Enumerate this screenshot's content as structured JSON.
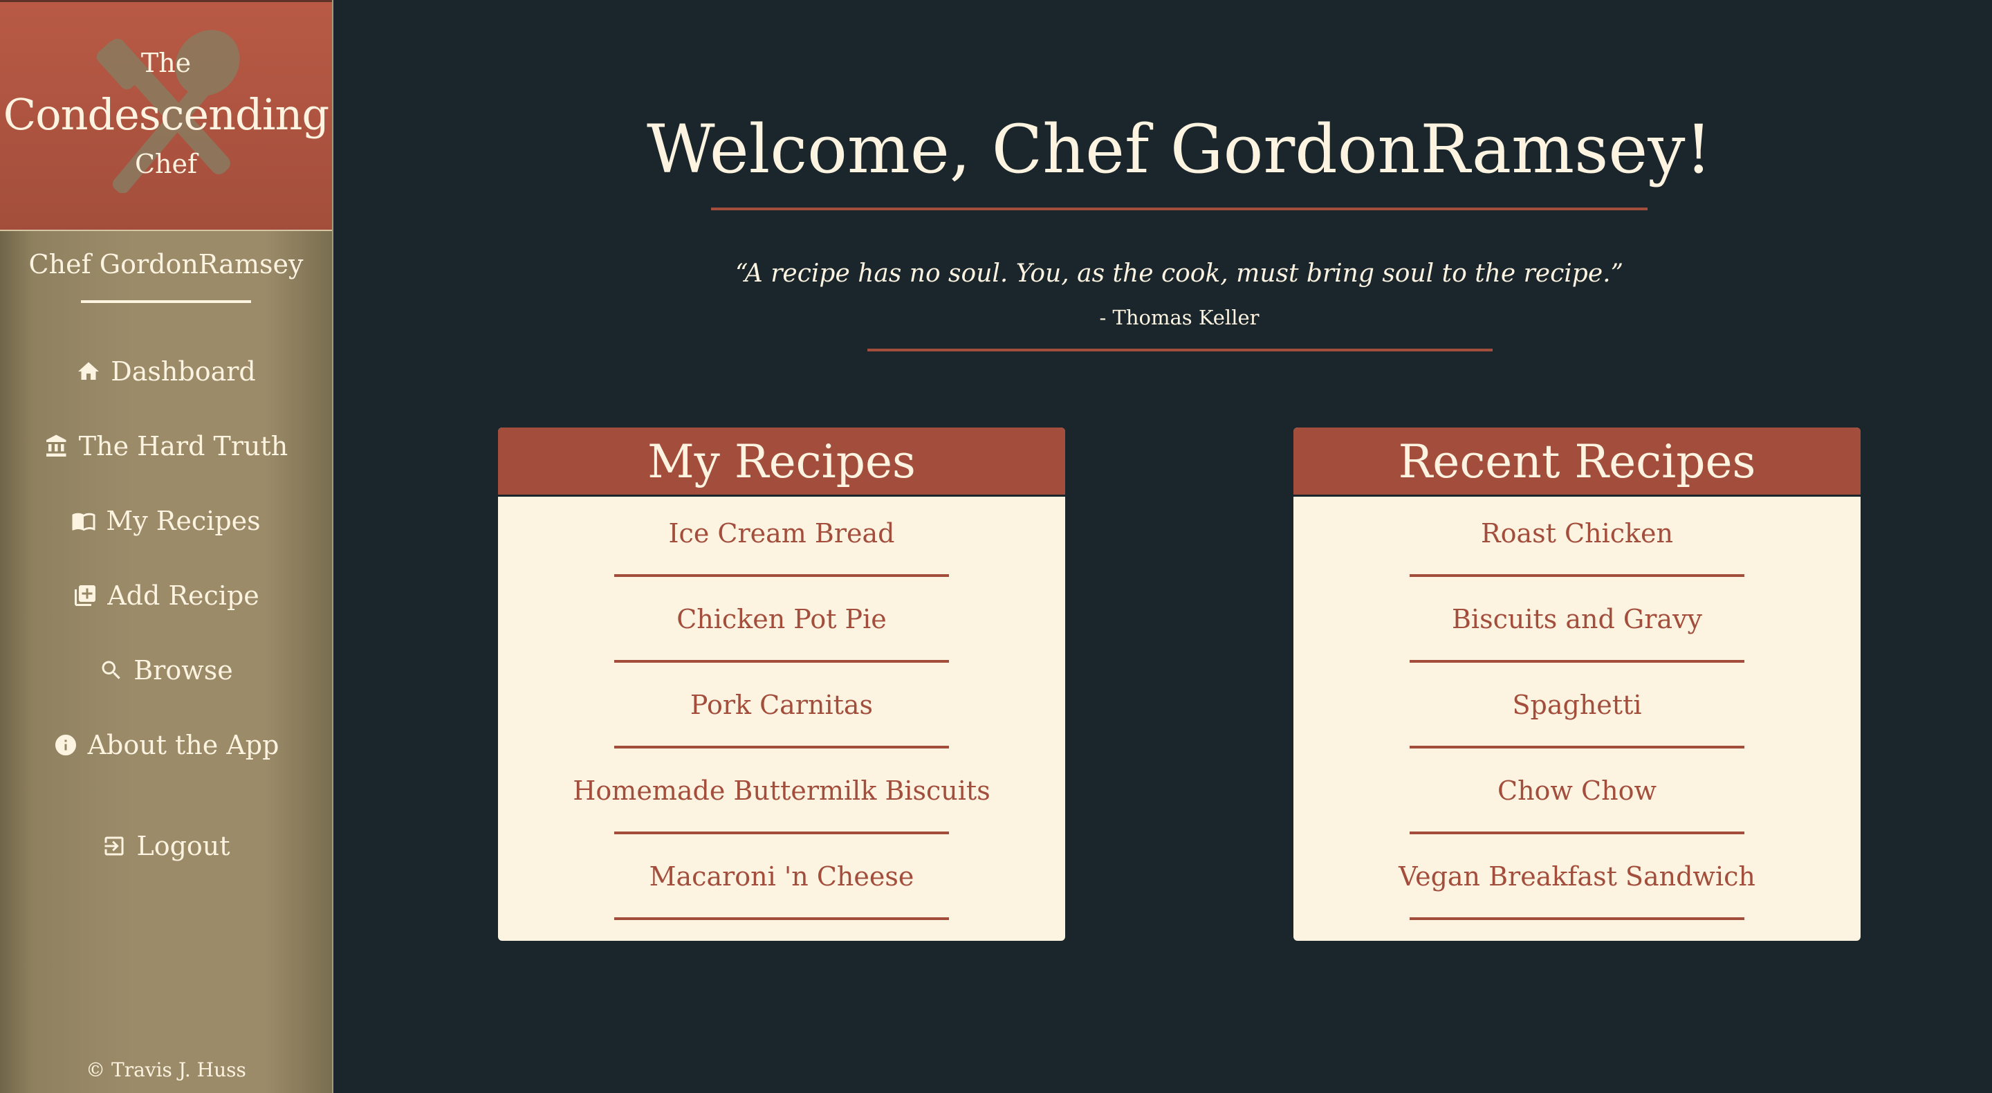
{
  "app": {
    "logo": {
      "line1": "The",
      "line2": "Condescending",
      "line3": "Chef",
      "art": "crossed-fork-spoon-icon"
    },
    "footer": "© Travis J. Huss"
  },
  "sidebar": {
    "chef_name": "Chef GordonRamsey",
    "items": [
      {
        "label": "Dashboard",
        "icon": "home-icon"
      },
      {
        "label": "The Hard Truth",
        "icon": "bank-icon"
      },
      {
        "label": "My Recipes",
        "icon": "book-open-icon"
      },
      {
        "label": "Add Recipe",
        "icon": "add-box-icon"
      },
      {
        "label": "Browse",
        "icon": "search-icon"
      },
      {
        "label": "About the App",
        "icon": "info-icon"
      },
      {
        "label": "Logout",
        "icon": "logout-icon"
      }
    ]
  },
  "main": {
    "welcome": "Welcome, Chef GordonRamsey!",
    "quote": "“A recipe has no soul. You, as the cook, must bring soul to the recipe.”",
    "quote_author": "- Thomas Keller",
    "my_recipes": {
      "title": "My Recipes",
      "items": [
        "Ice Cream Bread",
        "Chicken Pot Pie",
        "Pork Carnitas",
        "Homemade Buttermilk Biscuits",
        "Macaroni 'n Cheese"
      ]
    },
    "recent_recipes": {
      "title": "Recent Recipes",
      "items": [
        "Roast Chicken",
        "Biscuits and Gravy",
        "Spaghetti",
        "Chow Chow",
        "Vegan Breakfast Sandwich"
      ]
    }
  },
  "colors": {
    "background": "#1a262b",
    "accent": "#a34e3c",
    "cream": "#fcf3e0",
    "sidebar": "#9b8b69"
  }
}
